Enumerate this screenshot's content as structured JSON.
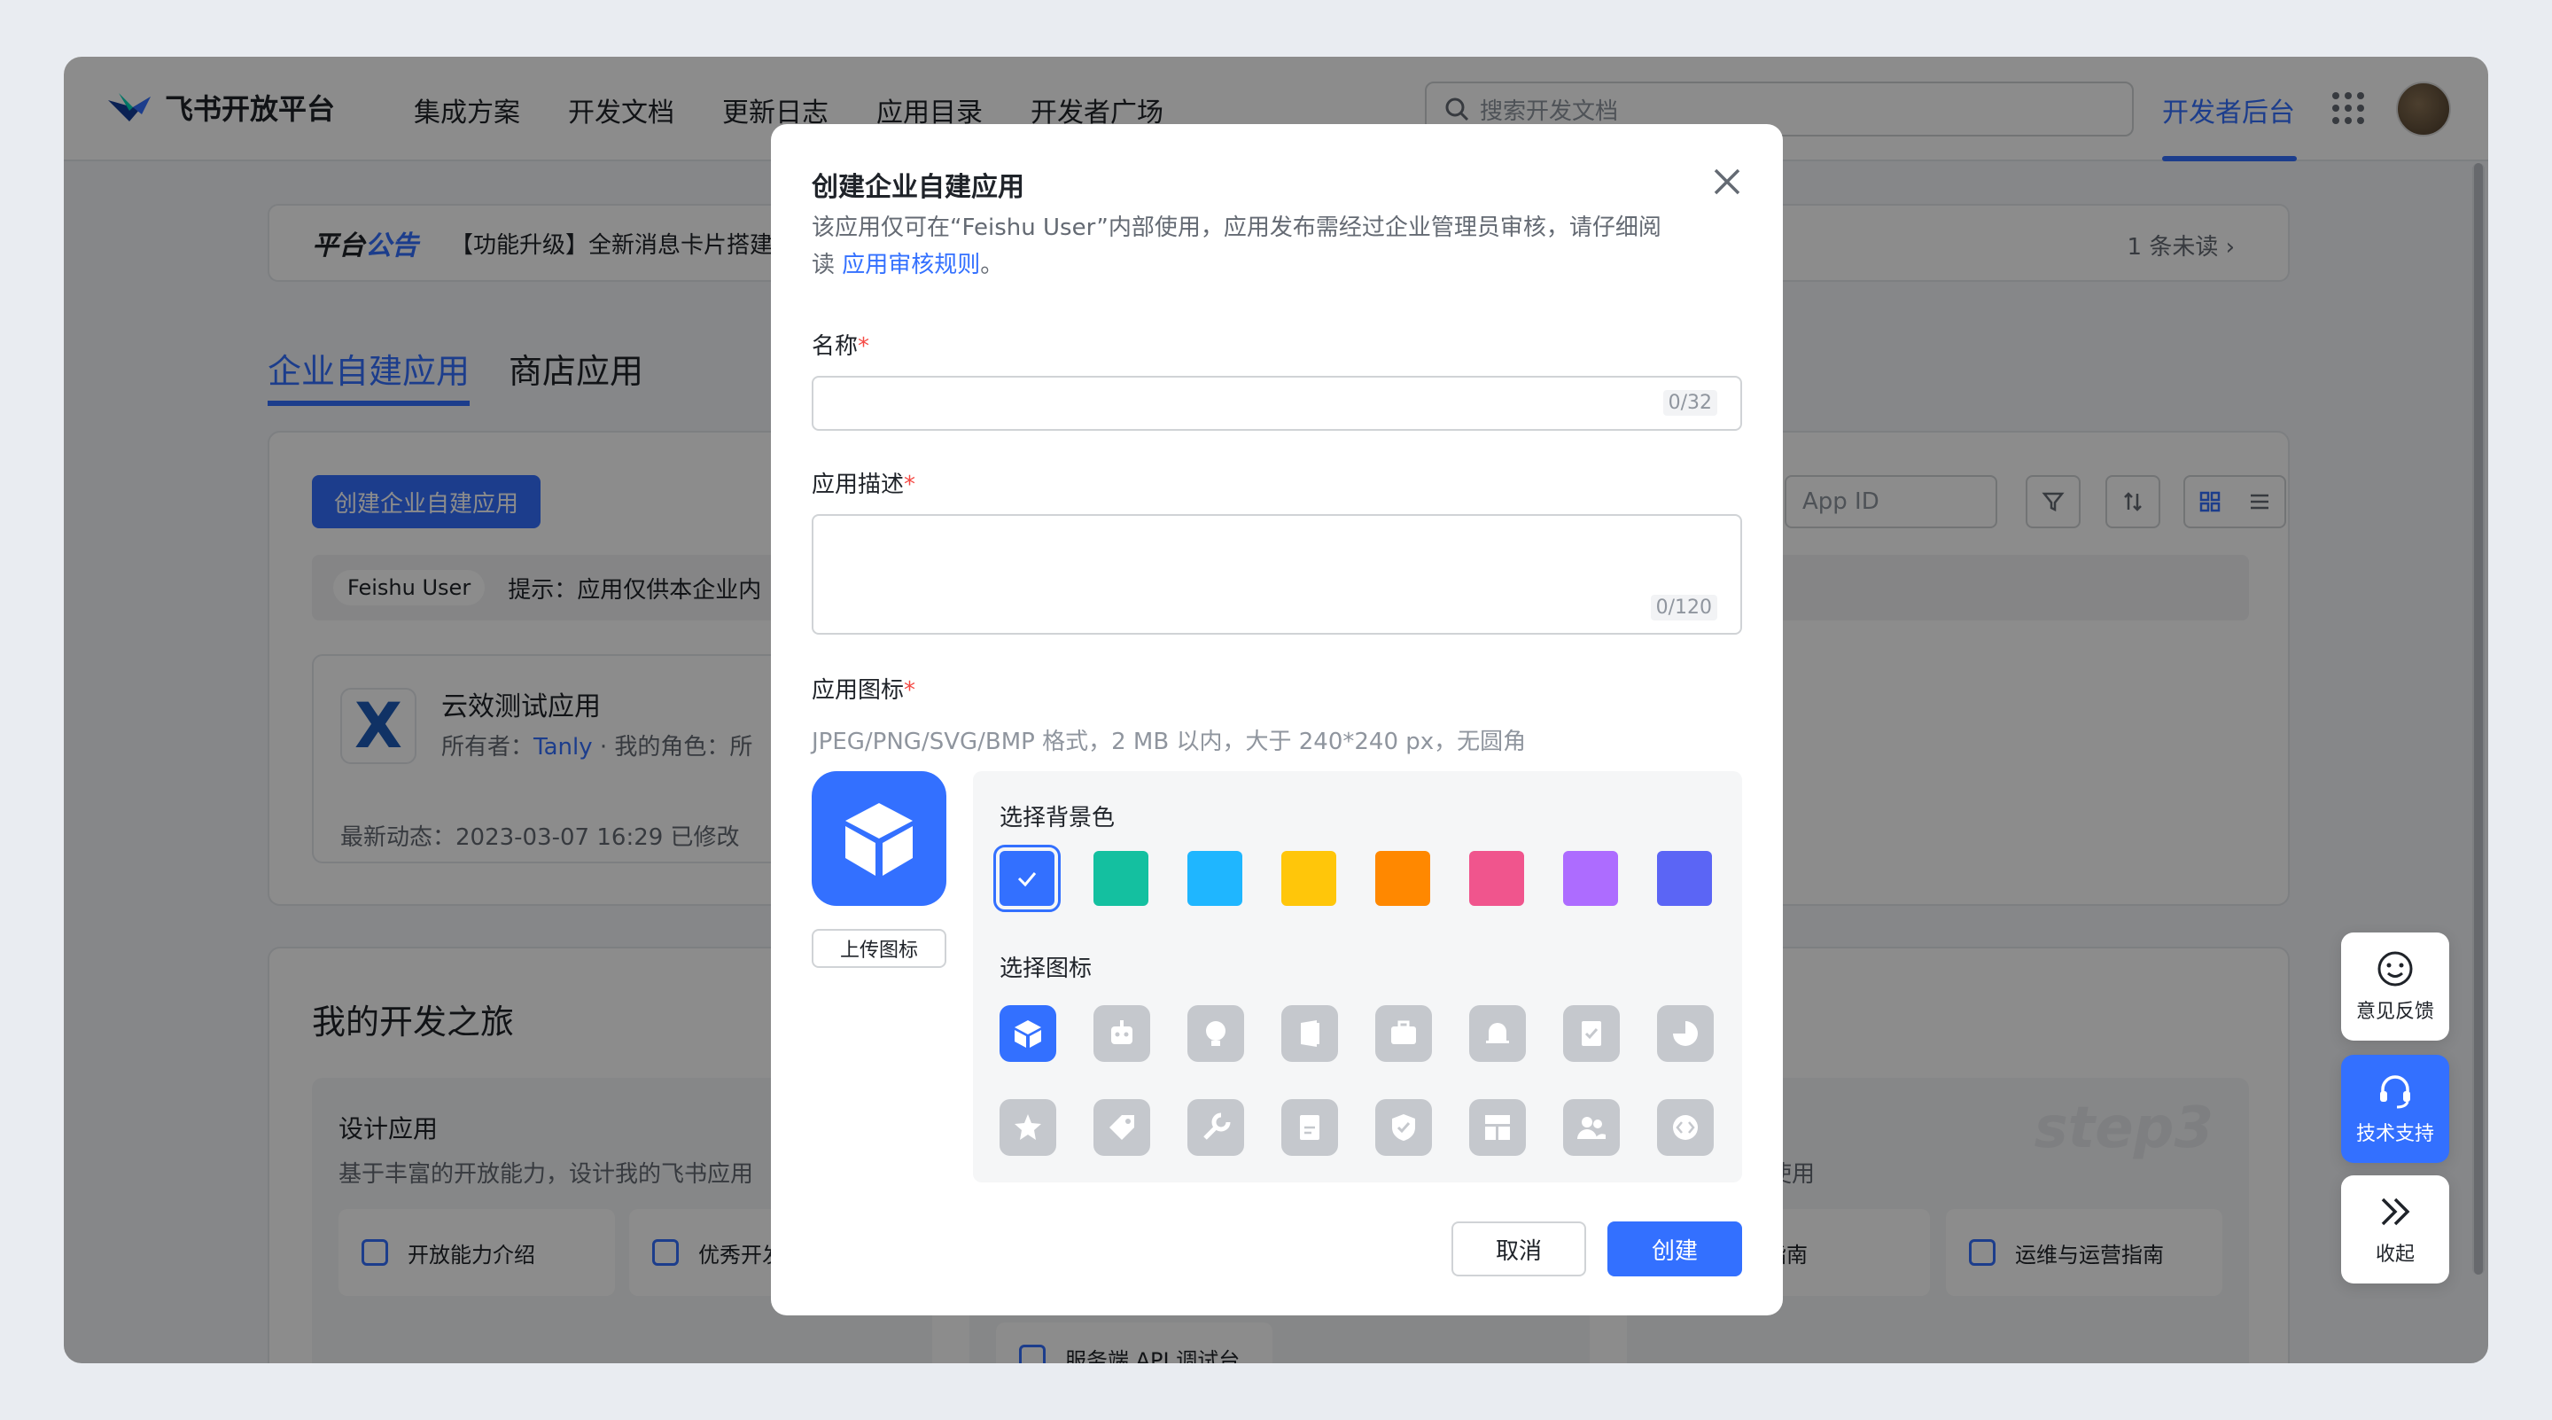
{
  "header": {
    "logo_text": "飞书开放平台",
    "nav": [
      "集成方案",
      "开发文档",
      "更新日志",
      "应用目录",
      "开发者广场"
    ],
    "search_placeholder": "搜索开发文档",
    "dev_console": "开发者后台"
  },
  "notice": {
    "title_a": "平台",
    "title_b": "公告",
    "text": "【功能升级】全新消息卡片搭建",
    "unread": "1 条未读 ›"
  },
  "tabs": [
    "企业自建应用",
    "商店应用"
  ],
  "apps_panel": {
    "create_button": "创建企业自建应用",
    "org": "Feishu User",
    "tip": "提示：应用仅供本企业内",
    "search_placeholder": "App ID",
    "app": {
      "name": "云效测试应用",
      "owner_label": "所有者：",
      "owner": "Tanly",
      "role": "· 我的角色：所",
      "date": "最新动态：2023-03-07 16:29 已修改"
    }
  },
  "journey": {
    "title": "我的开发之旅",
    "design_title": "设计应用",
    "design_desc": "基于丰富的开放能力，设计我的飞书应用",
    "btn1": "开放能力介绍",
    "btn2": "优秀开发",
    "btn3": "服务端 API 调试台",
    "publish_desc": "审核后即可使用",
    "btn4": "发布指南",
    "btn5": "运维与运营指南",
    "step": "step3"
  },
  "float_buttons": [
    "意见反馈",
    "技术支持",
    "收起"
  ],
  "modal": {
    "title": "创建企业自建应用",
    "desc": "该应用仅可在“Feishu User”内部使用，应用发布需经过企业管理员审核，请仔细阅读",
    "desc_link": "应用审核规则",
    "desc_end": "。",
    "name_label": "名称",
    "name_count": "0/32",
    "desc_label": "应用描述",
    "desc_count": "0/120",
    "icon_label": "应用图标",
    "required_mark": "*",
    "icon_hint": "JPEG/PNG/SVG/BMP 格式，2 MB 以内，大于 240*240 px，无圆角",
    "upload_button": "上传图标",
    "bg_label": "选择背景色",
    "bg_colors": [
      "#3370ff",
      "#14c0a0",
      "#1fb6ff",
      "#ffc60a",
      "#ff8800",
      "#f0558d",
      "#ad6cff",
      "#5b65f5"
    ],
    "icons_label": "选择图标",
    "icons": [
      "cube-icon",
      "robot-icon",
      "bulb-icon",
      "door-icon",
      "briefcase-icon",
      "bell-icon",
      "checklist-icon",
      "pie-icon",
      "star-icon",
      "tag-icon",
      "wrench-icon",
      "doc-icon",
      "shield-icon",
      "layout-icon",
      "people-icon",
      "code-icon"
    ],
    "cancel": "取消",
    "create": "创建"
  }
}
